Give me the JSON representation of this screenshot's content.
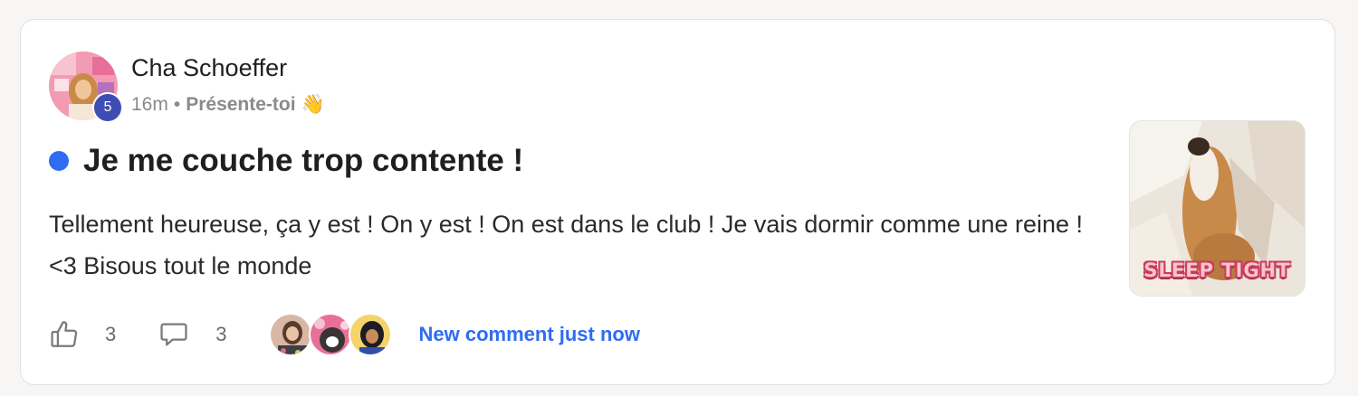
{
  "post": {
    "author": {
      "name": "Cha Schoeffer",
      "level": "5",
      "avatar_icon": "avatar-photo"
    },
    "meta": {
      "time": "16m",
      "separator": "•",
      "space": "Présente-toi",
      "space_emoji": "👋"
    },
    "title": "Je me couche trop contente !",
    "unread_dot_color": "#2f6cf2",
    "body": "Tellement heureuse, ça y est ! On y est ! On est dans le club ! Je vais dormir comme une reine ! <3 Bisous tout le monde",
    "thumbnail": {
      "caption": "SLEEP TIGHT",
      "icon": "sleeping-dog-gif"
    },
    "actions": {
      "likes": "3",
      "comments": "3",
      "commenter_avatars": [
        "commenter-avatar-1",
        "commenter-avatar-2",
        "commenter-avatar-3"
      ],
      "new_comment_label": "New comment just now"
    }
  },
  "colors": {
    "accent": "#2f6cf2",
    "badge": "#3f4db3",
    "muted": "#8a8a8a"
  }
}
